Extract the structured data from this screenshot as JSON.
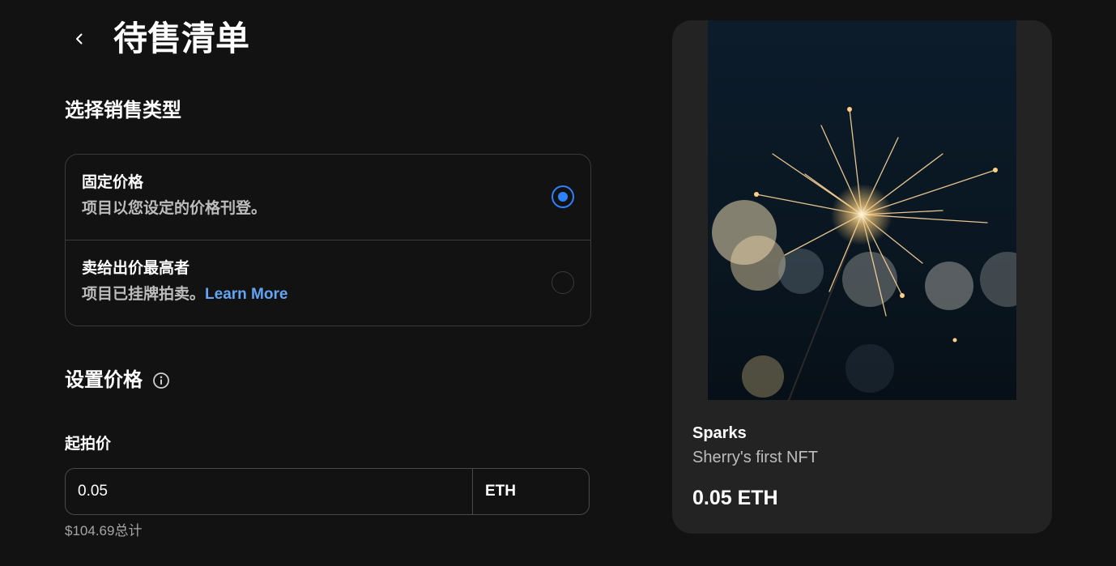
{
  "header": {
    "title": "待售清单",
    "back_icon": "chevron-left-icon"
  },
  "sale_type": {
    "title": "选择销售类型",
    "options": [
      {
        "title": "固定价格",
        "description": "项目以您设定的价格刊登。",
        "selected": true
      },
      {
        "title": "卖给出价最高者",
        "description": "项目已挂牌拍卖。",
        "link": "Learn More",
        "selected": false
      }
    ]
  },
  "price": {
    "title": "设置价格",
    "info_icon": "info-icon",
    "starting_price_label": "起拍价",
    "input_value": "0.05",
    "currency": "ETH",
    "total_usd": "$104.69总计"
  },
  "preview": {
    "name": "Sparks",
    "description": "Sherry's first NFT",
    "price": "0.05 ETH"
  },
  "colors": {
    "background": "#121212",
    "accent": "#2d81ff",
    "link": "#64a4f5",
    "card": "#232323"
  }
}
